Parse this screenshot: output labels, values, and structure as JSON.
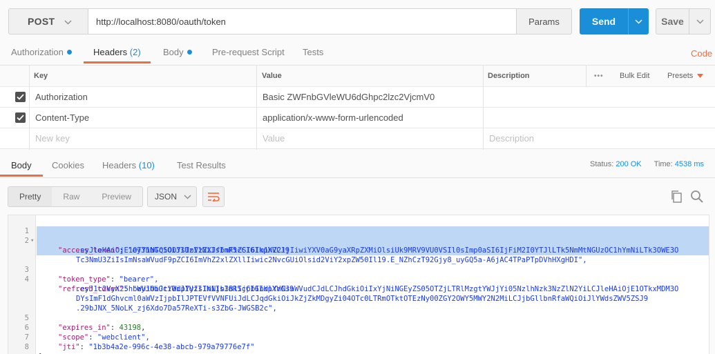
{
  "request": {
    "method": "POST",
    "url": "http://localhost:8080/oauth/token",
    "params_label": "Params",
    "send_label": "Send",
    "save_label": "Save"
  },
  "request_tabs": {
    "authorization": "Authorization",
    "headers": "Headers",
    "headers_count": "(2)",
    "body": "Body",
    "pre_request": "Pre-request Script",
    "tests": "Tests",
    "code": "Code"
  },
  "headers_table": {
    "col_key": "Key",
    "col_value": "Value",
    "col_description": "Description",
    "more": "•••",
    "bulk_edit": "Bulk Edit",
    "presets": "Presets",
    "rows": [
      {
        "key": "Authorization",
        "value": "Basic ZWFnbGVleWU6dGhpc2lzc2VjcmV0"
      },
      {
        "key": "Content-Type",
        "value": "application/x-www-form-urlencoded"
      }
    ],
    "new_key_placeholder": "New key",
    "new_value_placeholder": "Value",
    "new_description_placeholder": "Description"
  },
  "response_tabs": {
    "body": "Body",
    "cookies": "Cookies",
    "headers": "Headers",
    "headers_count": "(10)",
    "test_results": "Test Results"
  },
  "status": {
    "status_label": "Status:",
    "status_value": "200 OK",
    "time_label": "Time:",
    "time_value": "4538 ms"
  },
  "response_toolbar": {
    "pretty": "Pretty",
    "raw": "Raw",
    "preview": "Preview",
    "format": "JSON"
  },
  "response_body": {
    "line_numbers": [
      "1",
      "2",
      "3",
      "4",
      "5",
      "6",
      "7",
      "8"
    ],
    "open_brace": "{",
    "close_brace": "}",
    "access_token_key": "\"access_token\"",
    "access_token_1": "\"eyJhbGciOiJIUzI1NiIsInR5cCI6IkpXVCJ9",
    "access_token_2": ".eyJleHAiOjE1OTY1NTQ5ODYsInVzZXJfbmFtZSI6Im1hZ2ljIiwiYXV0aG9yaXRpZXMiOlsiUk9MRV9VU0VSIl0sImp0aSI6IjFiM2I0YTJlLTk5NmMtNGUzOC1hYmNiLTk3OWE3O",
    "access_token_3": "Tc3NmU3ZiIsImNsaWVudF9pZCI6ImVhZ2xlZXllIiwic2NvcGUiOlsid2ViY2xpZW50Il19.E_NZhCzT92Gjy8_uyGQ5a-A6jAC4TPaPTpDVhHXgHDI\",",
    "token_type_key": "\"token_type\"",
    "token_type_value": "\"bearer\",",
    "refresh_token_key": "\"refresh_token\"",
    "refresh_token_1": "\"eyJhbGciOiJIUzI1NiIsInR5cCI6IkpXVCJ9",
    "refresh_token_2": ".eyJ1c2VyX25hbWUiOiJtYWdpYyIsInNjb3BlIjpbIndlYmNsaWVudCJdLCJhdGkiOiIxYjNiNGEyZS05OTZjLTRlMzgtYWJjYi05NzlhNzk3NzZlN2YiLCJleHAiOjE1OTkxMDM3O",
    "refresh_token_3": "DYsImF1dGhvcml0aWVzIjpbIlJPTEVfVVNFUiJdLCJqdGkiOiJkZjZkMDgyZi04OTc0LTRmOTktOTEzNy00ZGY2OWY5MWY2N2MiLCJjbGllbnRfaWQiOiJlYWdsZWV5ZSJ9",
    "refresh_token_4": ".29bJNX_5NoLK_zj6Xdo7Da57ReXTi-s3ZbG-JWGSB2c\",",
    "expires_in_key": "\"expires_in\"",
    "expires_in_value": "43198",
    "scope_key": "\"scope\"",
    "scope_value": "\"webclient\",",
    "jti_key": "\"jti\"",
    "jti_value": "\"1b3b4a2e-996c-4e38-abcb-979a79776e7f\""
  },
  "colors": {
    "accent": "#1a8ed6",
    "tab_underline": "#f26b3a",
    "selection": "#bdd7f5"
  },
  "icons": [
    "chevron-down-icon",
    "checkbox-checked-icon",
    "wrap-lines-icon",
    "copy-icon",
    "search-icon",
    "more-icon",
    "caret-down-icon"
  ]
}
